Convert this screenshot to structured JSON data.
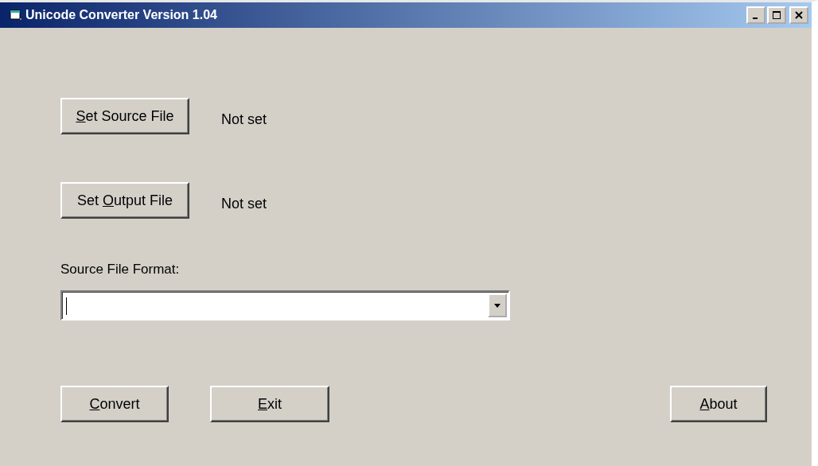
{
  "window": {
    "title": "Unicode Converter Version 1.04"
  },
  "file_rows": [
    {
      "button": [
        {
          "text": "S",
          "underlined": true
        },
        {
          "text": "et Source File",
          "underlined": false
        }
      ],
      "status": "Not set"
    },
    {
      "button": [
        {
          "text": "Set ",
          "underlined": false
        },
        {
          "text": "O",
          "underlined": true
        },
        {
          "text": "utput File",
          "underlined": false
        }
      ],
      "status": "Not set"
    }
  ],
  "format": {
    "label": "Source File Format:"
  },
  "buttons": [
    {
      "label": [
        {
          "text": "C",
          "underlined": true
        },
        {
          "text": "onvert",
          "underlined": false
        }
      ],
      "kind": "left"
    },
    {
      "label": [
        {
          "text": "E",
          "underlined": true
        },
        {
          "text": "xit",
          "underlined": false
        }
      ],
      "kind": "left"
    },
    {
      "label": [
        {
          "text": "A",
          "underlined": true
        },
        {
          "text": "bout",
          "underlined": false
        }
      ],
      "kind": "right"
    }
  ]
}
